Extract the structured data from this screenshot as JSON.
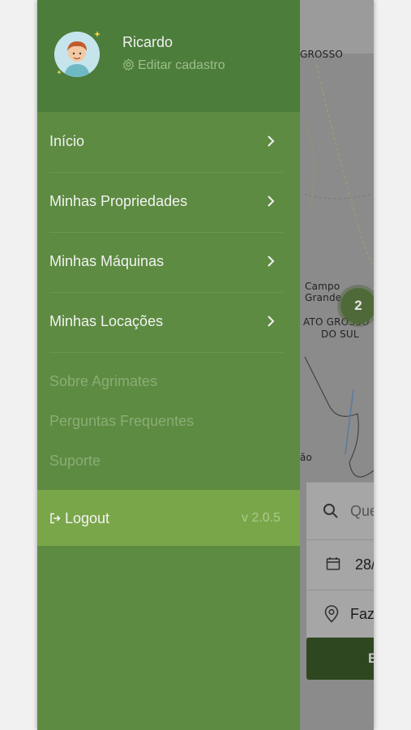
{
  "profile": {
    "name": "Ricardo",
    "edit_label": "Editar cadastro"
  },
  "nav": {
    "items": [
      {
        "label": "Início"
      },
      {
        "label": "Minhas Propriedades"
      },
      {
        "label": "Minhas Máquinas"
      },
      {
        "label": "Minhas Locações"
      }
    ]
  },
  "secondary": {
    "about": "Sobre Agrimates",
    "faq": "Perguntas Frequentes",
    "support": "Suporte"
  },
  "logout": {
    "label": "Logout",
    "version": "v 2.0.5"
  },
  "map": {
    "label_top": "GROSSO",
    "label_city": "Campo Grande",
    "label_state_1": "ATO GROSSO",
    "label_state_2": "DO SUL",
    "label_partial": "ão",
    "cluster_count": "2"
  },
  "search_panel": {
    "search_placeholder": "Que",
    "date_value": "28/",
    "location_value": "Faz",
    "button_label": "B"
  },
  "colors": {
    "drawer_bg": "#5d8b41",
    "profile_bg": "#4c7d3b",
    "logout_bg": "#7aa64a"
  }
}
